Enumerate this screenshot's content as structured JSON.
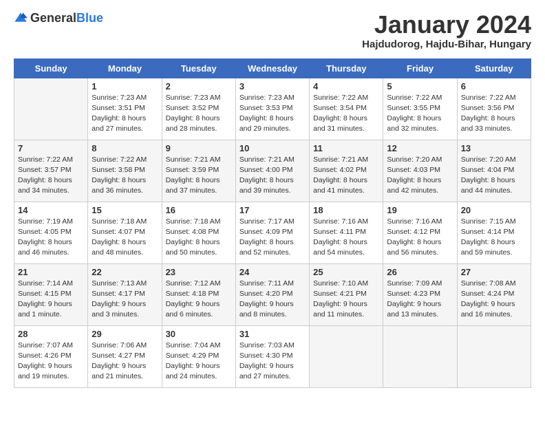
{
  "header": {
    "logo_general": "General",
    "logo_blue": "Blue",
    "month_title": "January 2024",
    "location": "Hajdudorog, Hajdu-Bihar, Hungary"
  },
  "days_of_week": [
    "Sunday",
    "Monday",
    "Tuesday",
    "Wednesday",
    "Thursday",
    "Friday",
    "Saturday"
  ],
  "weeks": [
    [
      {
        "day": "",
        "info": ""
      },
      {
        "day": "1",
        "info": "Sunrise: 7:23 AM\nSunset: 3:51 PM\nDaylight: 8 hours\nand 27 minutes."
      },
      {
        "day": "2",
        "info": "Sunrise: 7:23 AM\nSunset: 3:52 PM\nDaylight: 8 hours\nand 28 minutes."
      },
      {
        "day": "3",
        "info": "Sunrise: 7:23 AM\nSunset: 3:53 PM\nDaylight: 8 hours\nand 29 minutes."
      },
      {
        "day": "4",
        "info": "Sunrise: 7:22 AM\nSunset: 3:54 PM\nDaylight: 8 hours\nand 31 minutes."
      },
      {
        "day": "5",
        "info": "Sunrise: 7:22 AM\nSunset: 3:55 PM\nDaylight: 8 hours\nand 32 minutes."
      },
      {
        "day": "6",
        "info": "Sunrise: 7:22 AM\nSunset: 3:56 PM\nDaylight: 8 hours\nand 33 minutes."
      }
    ],
    [
      {
        "day": "7",
        "info": "Sunrise: 7:22 AM\nSunset: 3:57 PM\nDaylight: 8 hours\nand 34 minutes."
      },
      {
        "day": "8",
        "info": "Sunrise: 7:22 AM\nSunset: 3:58 PM\nDaylight: 8 hours\nand 36 minutes."
      },
      {
        "day": "9",
        "info": "Sunrise: 7:21 AM\nSunset: 3:59 PM\nDaylight: 8 hours\nand 37 minutes."
      },
      {
        "day": "10",
        "info": "Sunrise: 7:21 AM\nSunset: 4:00 PM\nDaylight: 8 hours\nand 39 minutes."
      },
      {
        "day": "11",
        "info": "Sunrise: 7:21 AM\nSunset: 4:02 PM\nDaylight: 8 hours\nand 41 minutes."
      },
      {
        "day": "12",
        "info": "Sunrise: 7:20 AM\nSunset: 4:03 PM\nDaylight: 8 hours\nand 42 minutes."
      },
      {
        "day": "13",
        "info": "Sunrise: 7:20 AM\nSunset: 4:04 PM\nDaylight: 8 hours\nand 44 minutes."
      }
    ],
    [
      {
        "day": "14",
        "info": "Sunrise: 7:19 AM\nSunset: 4:05 PM\nDaylight: 8 hours\nand 46 minutes."
      },
      {
        "day": "15",
        "info": "Sunrise: 7:18 AM\nSunset: 4:07 PM\nDaylight: 8 hours\nand 48 minutes."
      },
      {
        "day": "16",
        "info": "Sunrise: 7:18 AM\nSunset: 4:08 PM\nDaylight: 8 hours\nand 50 minutes."
      },
      {
        "day": "17",
        "info": "Sunrise: 7:17 AM\nSunset: 4:09 PM\nDaylight: 8 hours\nand 52 minutes."
      },
      {
        "day": "18",
        "info": "Sunrise: 7:16 AM\nSunset: 4:11 PM\nDaylight: 8 hours\nand 54 minutes."
      },
      {
        "day": "19",
        "info": "Sunrise: 7:16 AM\nSunset: 4:12 PM\nDaylight: 8 hours\nand 56 minutes."
      },
      {
        "day": "20",
        "info": "Sunrise: 7:15 AM\nSunset: 4:14 PM\nDaylight: 8 hours\nand 59 minutes."
      }
    ],
    [
      {
        "day": "21",
        "info": "Sunrise: 7:14 AM\nSunset: 4:15 PM\nDaylight: 9 hours\nand 1 minute."
      },
      {
        "day": "22",
        "info": "Sunrise: 7:13 AM\nSunset: 4:17 PM\nDaylight: 9 hours\nand 3 minutes."
      },
      {
        "day": "23",
        "info": "Sunrise: 7:12 AM\nSunset: 4:18 PM\nDaylight: 9 hours\nand 6 minutes."
      },
      {
        "day": "24",
        "info": "Sunrise: 7:11 AM\nSunset: 4:20 PM\nDaylight: 9 hours\nand 8 minutes."
      },
      {
        "day": "25",
        "info": "Sunrise: 7:10 AM\nSunset: 4:21 PM\nDaylight: 9 hours\nand 11 minutes."
      },
      {
        "day": "26",
        "info": "Sunrise: 7:09 AM\nSunset: 4:23 PM\nDaylight: 9 hours\nand 13 minutes."
      },
      {
        "day": "27",
        "info": "Sunrise: 7:08 AM\nSunset: 4:24 PM\nDaylight: 9 hours\nand 16 minutes."
      }
    ],
    [
      {
        "day": "28",
        "info": "Sunrise: 7:07 AM\nSunset: 4:26 PM\nDaylight: 9 hours\nand 19 minutes."
      },
      {
        "day": "29",
        "info": "Sunrise: 7:06 AM\nSunset: 4:27 PM\nDaylight: 9 hours\nand 21 minutes."
      },
      {
        "day": "30",
        "info": "Sunrise: 7:04 AM\nSunset: 4:29 PM\nDaylight: 9 hours\nand 24 minutes."
      },
      {
        "day": "31",
        "info": "Sunrise: 7:03 AM\nSunset: 4:30 PM\nDaylight: 9 hours\nand 27 minutes."
      },
      {
        "day": "",
        "info": ""
      },
      {
        "day": "",
        "info": ""
      },
      {
        "day": "",
        "info": ""
      }
    ]
  ]
}
